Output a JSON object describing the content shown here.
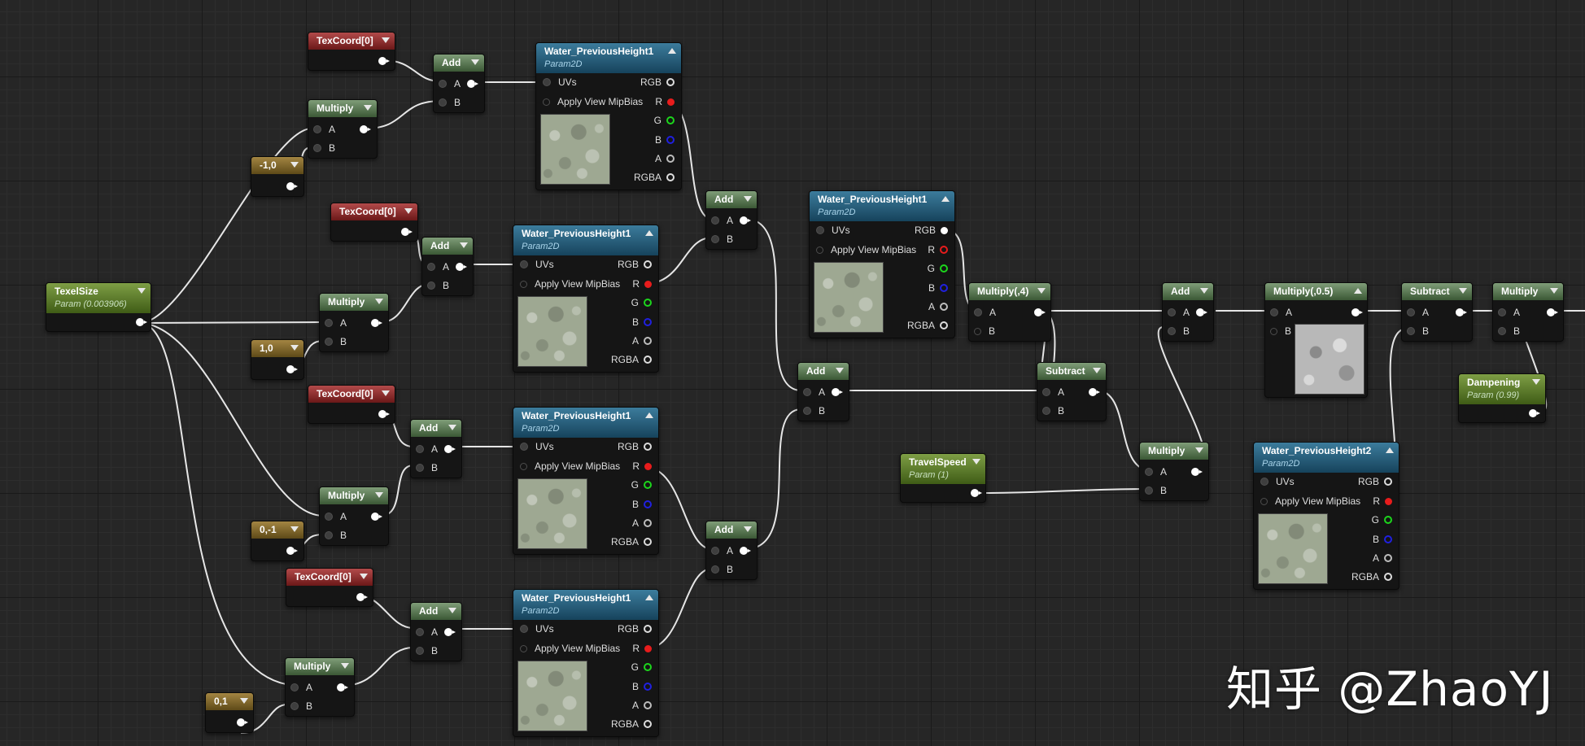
{
  "nodes": {
    "texel_size": {
      "title": "TexelSize",
      "subtitle": "Param (0.003906)"
    },
    "texcoord_1": {
      "title": "TexCoord[0]"
    },
    "texcoord_2": {
      "title": "TexCoord[0]"
    },
    "texcoord_3": {
      "title": "TexCoord[0]"
    },
    "texcoord_4": {
      "title": "TexCoord[0]"
    },
    "const_1": {
      "title": "-1,0"
    },
    "const_2": {
      "title": "1,0"
    },
    "const_3": {
      "title": "0,-1"
    },
    "const_4": {
      "title": "0,1"
    },
    "multiply_1": {
      "title": "Multiply",
      "pin_a": "A",
      "pin_b": "B"
    },
    "multiply_2": {
      "title": "Multiply",
      "pin_a": "A",
      "pin_b": "B"
    },
    "multiply_3": {
      "title": "Multiply",
      "pin_a": "A",
      "pin_b": "B"
    },
    "multiply_4": {
      "title": "Multiply",
      "pin_a": "A",
      "pin_b": "B"
    },
    "add_1": {
      "title": "Add",
      "pin_a": "A",
      "pin_b": "B"
    },
    "add_2": {
      "title": "Add",
      "pin_a": "A",
      "pin_b": "B"
    },
    "add_3": {
      "title": "Add",
      "pin_a": "A",
      "pin_b": "B"
    },
    "add_4": {
      "title": "Add",
      "pin_a": "A",
      "pin_b": "B"
    },
    "sample_1": {
      "title": "Water_PreviousHeight1",
      "subtitle": "Param2D",
      "uvs": "UVs",
      "mip": "Apply View MipBias",
      "rgb": "RGB",
      "r": "R",
      "g": "G",
      "b": "B",
      "a": "A",
      "rgba": "RGBA"
    },
    "sample_2": {
      "title": "Water_PreviousHeight1",
      "subtitle": "Param2D",
      "uvs": "UVs",
      "mip": "Apply View MipBias",
      "rgb": "RGB",
      "r": "R",
      "g": "G",
      "b": "B",
      "a": "A",
      "rgba": "RGBA"
    },
    "sample_3": {
      "title": "Water_PreviousHeight1",
      "subtitle": "Param2D",
      "uvs": "UVs",
      "mip": "Apply View MipBias",
      "rgb": "RGB",
      "r": "R",
      "g": "G",
      "b": "B",
      "a": "A",
      "rgba": "RGBA"
    },
    "sample_4": {
      "title": "Water_PreviousHeight1",
      "subtitle": "Param2D",
      "uvs": "UVs",
      "mip": "Apply View MipBias",
      "rgb": "RGB",
      "r": "R",
      "g": "G",
      "b": "B",
      "a": "A",
      "rgba": "RGBA"
    },
    "sample_5": {
      "title": "Water_PreviousHeight1",
      "subtitle": "Param2D",
      "uvs": "UVs",
      "mip": "Apply View MipBias",
      "rgb": "RGB",
      "r": "R",
      "g": "G",
      "b": "B",
      "a": "A",
      "rgba": "RGBA"
    },
    "sample_6": {
      "title": "Water_PreviousHeight2",
      "subtitle": "Param2D",
      "uvs": "UVs",
      "mip": "Apply View MipBias",
      "rgb": "RGB",
      "r": "R",
      "g": "G",
      "b": "B",
      "a": "A",
      "rgba": "RGBA"
    },
    "sum_add_1": {
      "title": "Add",
      "pin_a": "A",
      "pin_b": "B"
    },
    "sum_add_2": {
      "title": "Add",
      "pin_a": "A",
      "pin_b": "B"
    },
    "sum_add_3": {
      "title": "Add",
      "pin_a": "A",
      "pin_b": "B"
    },
    "multiply_4x": {
      "title": "Multiply(,4)",
      "pin_a": "A",
      "pin_b": "B"
    },
    "subtract_1": {
      "title": "Subtract",
      "pin_a": "A",
      "pin_b": "B"
    },
    "travel_speed": {
      "title": "TravelSpeed",
      "subtitle": "Param (1)"
    },
    "multiply_speed": {
      "title": "Multiply",
      "pin_a": "A",
      "pin_b": "B"
    },
    "add_final": {
      "title": "Add",
      "pin_a": "A",
      "pin_b": "B"
    },
    "multiply_half": {
      "title": "Multiply(,0.5)",
      "pin_a": "A",
      "pin_b": "B"
    },
    "subtract_2": {
      "title": "Subtract",
      "pin_a": "A",
      "pin_b": "B"
    },
    "multiply_damp": {
      "title": "Multiply",
      "pin_a": "A",
      "pin_b": "B"
    },
    "dampening": {
      "title": "Dampening",
      "subtitle": "Param (0.99)"
    }
  },
  "watermark": "知乎 @ZhaoYJ",
  "colors": {
    "red_channel": "#e81c1c",
    "green_channel": "#1cd61c",
    "blue_channel": "#2020e0",
    "wire": "#e6e6e6"
  }
}
